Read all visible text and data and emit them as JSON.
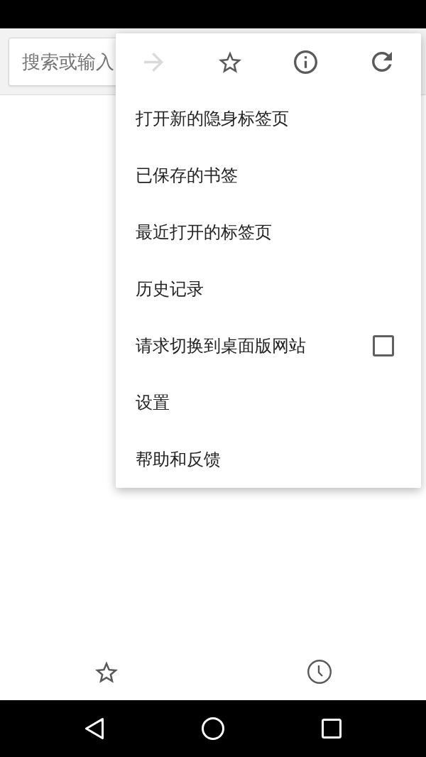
{
  "toolbar": {
    "search": {
      "placeholder": "搜索或输入"
    }
  },
  "menu": {
    "actions": [
      {
        "disabled": true
      },
      {
        "disabled": false
      },
      {
        "disabled": false
      },
      {
        "disabled": false
      }
    ],
    "items": [
      {
        "label": "打开新的隐身标签页"
      },
      {
        "label": "已保存的书签"
      },
      {
        "label": "最近打开的标签页"
      },
      {
        "label": "历史记录"
      },
      {
        "label": "请求切换到桌面版网站",
        "checkbox": {
          "checked": false
        }
      },
      {
        "label": "设置"
      },
      {
        "label": "帮助和反馈"
      }
    ]
  }
}
